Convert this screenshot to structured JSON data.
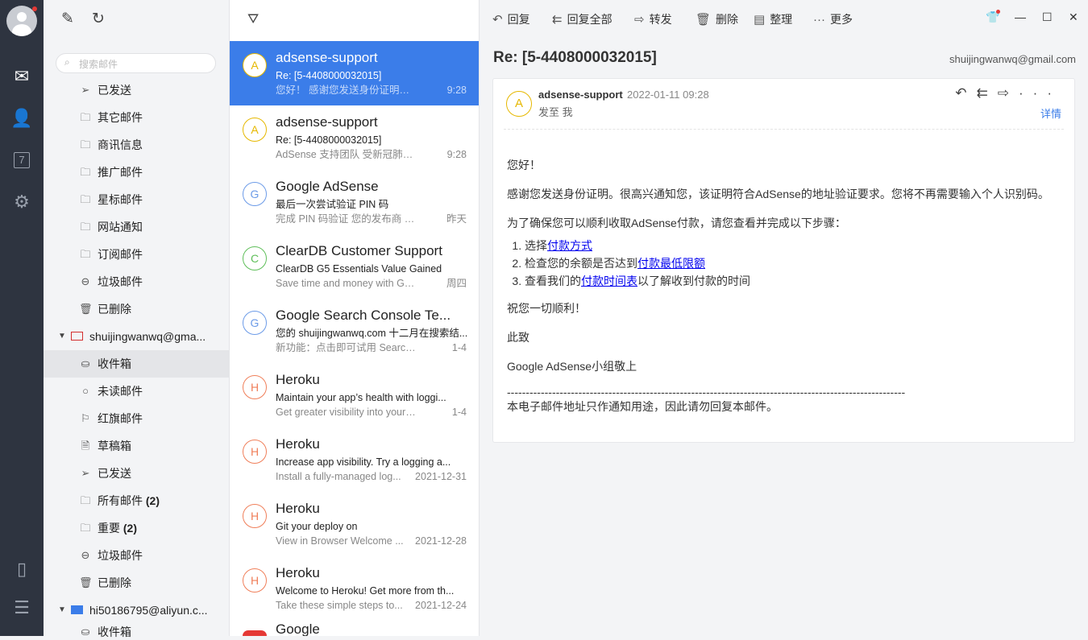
{
  "rail": {
    "items": [
      "mail-icon",
      "contacts-icon",
      "calendar-icon",
      "settings-icon",
      "phone-icon",
      "menu-icon"
    ],
    "calendar_day": "7"
  },
  "search": {
    "placeholder": "搜索邮件"
  },
  "folders_top": [
    {
      "label": "已发送",
      "icon": "send-icon"
    },
    {
      "label": "其它邮件",
      "icon": "folder-icon"
    },
    {
      "label": "商讯信息",
      "icon": "folder-icon"
    },
    {
      "label": "推广邮件",
      "icon": "folder-icon"
    },
    {
      "label": "星标邮件",
      "icon": "folder-icon"
    },
    {
      "label": "网站通知",
      "icon": "folder-icon"
    },
    {
      "label": "订阅邮件",
      "icon": "folder-icon"
    },
    {
      "label": "垃圾邮件",
      "icon": "spam-icon"
    },
    {
      "label": "已删除",
      "icon": "trash-icon"
    }
  ],
  "account1": {
    "email": "shuijingwanwq@gma...",
    "folders": [
      {
        "label": "收件箱",
        "selected": true
      },
      {
        "label": "未读邮件"
      },
      {
        "label": "红旗邮件"
      },
      {
        "label": "草稿箱"
      },
      {
        "label": "已发送"
      },
      {
        "label": "所有邮件",
        "count": "(2)"
      },
      {
        "label": "重要",
        "count": "(2)"
      },
      {
        "label": "垃圾邮件"
      },
      {
        "label": "已删除"
      }
    ]
  },
  "account2": {
    "email": "hi50186795@aliyun.c...",
    "folders": [
      {
        "label": "收件箱"
      }
    ]
  },
  "messages": [
    {
      "initial": "A",
      "color": "#e6b800",
      "from": "adsense-support",
      "subject": "Re: [5-4408000032015]",
      "preview": "您好！ 感谢您发送身份证明。很高兴...",
      "date": "9:28",
      "selected": true
    },
    {
      "initial": "A",
      "color": "#e6b800",
      "from": "adsense-support",
      "subject": "Re: [5-4408000032015]",
      "preview": "AdSense 支持团队 受新冠肺炎 (CO...",
      "date": "9:28"
    },
    {
      "initial": "G",
      "color": "#6c9be8",
      "from": "Google AdSense",
      "subject": "最后一次尝试验证 PIN 码",
      "preview": "完成 PIN 码验证 您的发布商 ID: pu...",
      "date": "昨天"
    },
    {
      "initial": "C",
      "color": "#5fbf5a",
      "from": "ClearDB Customer Support",
      "subject": "ClearDB G5 Essentials Value Gained",
      "preview": "Save time and money with G5. De...",
      "date": "周四"
    },
    {
      "initial": "G",
      "color": "#6c9be8",
      "from": "Google Search Console Te...",
      "subject": "您的 shuijingwanwq.com 十二月在搜索结...",
      "preview": "新功能：点击即可试用 Search Cons...",
      "date": "1-4"
    },
    {
      "initial": "H",
      "color": "#f07f5a",
      "from": "Heroku",
      "subject": "Maintain your app’s health with loggi...",
      "preview": "Get greater visibility into your app...",
      "date": "1-4"
    },
    {
      "initial": "H",
      "color": "#f07f5a",
      "from": "Heroku",
      "subject": "Increase app visibility. Try a logging a...",
      "preview": "Install a fully-managed log...",
      "date": "2021-12-31"
    },
    {
      "initial": "H",
      "color": "#f07f5a",
      "from": "Heroku",
      "subject": "Git your deploy on",
      "preview": "View in Browser Welcome ...",
      "date": "2021-12-28"
    },
    {
      "initial": "H",
      "color": "#f07f5a",
      "from": "Heroku",
      "subject": "Welcome to Heroku! Get more from th...",
      "preview": "Take these simple steps to...",
      "date": "2021-12-24"
    },
    {
      "initial": "G",
      "color": "#e53935",
      "from": "Google",
      "subject": "",
      "preview": "",
      "date": ""
    }
  ],
  "toolbar": {
    "reply": "回复",
    "reply_all": "回复全部",
    "forward": "转发",
    "delete": "删除",
    "organize": "整理",
    "more": "更多"
  },
  "reader": {
    "title": "Re: [5-4408000032015]",
    "account": "shuijingwanwq@gmail.com",
    "sender": "adsense-support",
    "initial": "A",
    "date": "2022-01-11 09:28",
    "to": "发至 我",
    "details": "详情",
    "greeting": "您好！",
    "p1": "感谢您发送身份证明。很高兴通知您，该证明符合AdSense的地址验证要求。您将不再需要输入个人识别码。",
    "p2": "为了确保您可以顺利收取AdSense付款，请您查看并完成以下步骤：",
    "steps": [
      {
        "pre": "选择",
        "link": "付款方式",
        "post": ""
      },
      {
        "pre": "检查您的余额是否达到",
        "link": "付款最低限额",
        "post": ""
      },
      {
        "pre": "查看我们的",
        "link": "付款时间表",
        "post": "以了解收到付款的时间"
      }
    ],
    "wish": "祝您一切顺利！",
    "closing": "此致",
    "signature": "Google AdSense小组敬上",
    "divider": "----------------------------------------------------------------------------------------------------------",
    "footer": "本电子邮件地址只作通知用途，因此请勿回复本邮件。"
  }
}
